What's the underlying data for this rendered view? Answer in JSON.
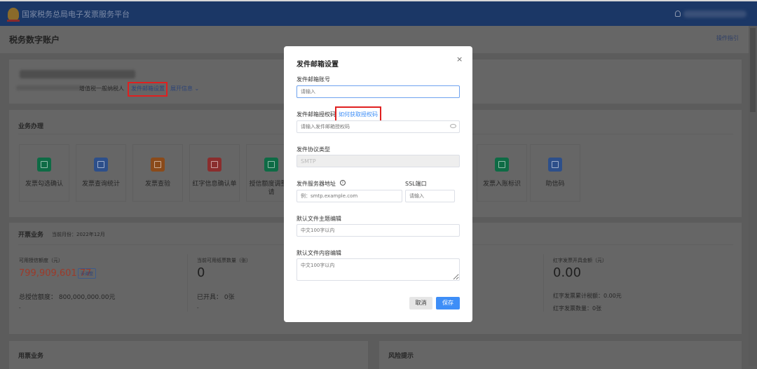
{
  "header": {
    "title": "国家税务总局电子发票服务平台",
    "icons": [
      "emblem-logo",
      "user-icon"
    ]
  },
  "page": {
    "title": "税务数字账户",
    "guide_link": "操作指引"
  },
  "account": {
    "taxpayer_type": "增值税一般纳税人",
    "mail_settings_link": "发件邮箱设置",
    "expand_link": "展开信息"
  },
  "business": {
    "title": "业务办理",
    "tiles": [
      {
        "label": "发票勾选确认",
        "color": "#0e6b45"
      },
      {
        "label": "发票查询统计",
        "color": "#2d4f8a"
      },
      {
        "label": "发票查验",
        "color": "#8a4a1a"
      },
      {
        "label": "红字信息确认单",
        "color": "#8a2d2d"
      },
      {
        "label": "授信额度调整申请",
        "color": "#0e6b45"
      },
      {
        "label": "发票入账标识",
        "color": "#0e6b45"
      },
      {
        "label": "助信码",
        "color": "#2d4f8a"
      }
    ]
  },
  "invoicing": {
    "title": "开票业务",
    "month": "当前月份：2022年12月",
    "credit_label": "可用授信额度（元）",
    "credit_value": "799,909,601.77",
    "adjust_button": "去调整",
    "total_credit": "总授信额度： 800,000,000.00元",
    "dash": "-",
    "paper_label": "当前可用纸票数量（张）",
    "paper_value": "0",
    "issued": "已开具： 0张",
    "red_label": "红字发票开具金额（元）",
    "red_value": "0.00",
    "red_tax": "红字发票累计税额：0.00元",
    "red_count": "红字发票数量：0张"
  },
  "usage": {
    "title": "用票业务"
  },
  "risk": {
    "title": "风险提示"
  },
  "modal": {
    "title": "发件邮箱设置",
    "account_label": "发件邮箱账号",
    "account_placeholder": "请输入",
    "auth_label": "发件邮箱授权码",
    "auth_help_link": "如何获取授权码",
    "auth_placeholder": "请输入发件邮箱授权码",
    "protocol_label": "发件协议类型",
    "protocol_value": "SMTP",
    "server_label": "发件服务器地址",
    "server_placeholder": "例：smtp.example.com",
    "port_label": "SSL端口",
    "port_placeholder": "请输入",
    "subject_label": "默认文件主题编辑",
    "subject_placeholder": "中文100字以内",
    "content_label": "默认文件内容编辑",
    "content_placeholder": "中文100字以内",
    "cancel": "取消",
    "save": "保存",
    "close": "×"
  },
  "colors": {
    "header": "#1b3766",
    "primary": "#3e8ef7",
    "highlight": "#e02020",
    "credit_value": "#9c3a2a"
  }
}
